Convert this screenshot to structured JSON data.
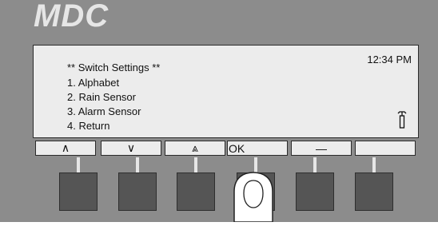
{
  "brand": {
    "name": "MDC"
  },
  "display": {
    "clock": "12:34 PM",
    "menu": {
      "title": "** Switch Settings **",
      "items": [
        "1. Alphabet",
        "2. Rain Sensor",
        "3. Alarm Sensor",
        "4. Return"
      ]
    },
    "status_icon": "signal-antenna-icon"
  },
  "softkeys": {
    "labels": [
      "∧",
      "∨",
      "⩓",
      "OK",
      "—",
      ""
    ],
    "icons": [
      "caret-up-icon",
      "caret-down-icon",
      "double-caret-up-icon",
      "",
      "dash-icon",
      ""
    ]
  },
  "hardware_buttons": {
    "count": 6,
    "pressed_index": 3
  },
  "colors": {
    "panel": "#8c8c8c",
    "screen": "#ececec",
    "button": "#555555",
    "brand": "#e6e6e6"
  }
}
